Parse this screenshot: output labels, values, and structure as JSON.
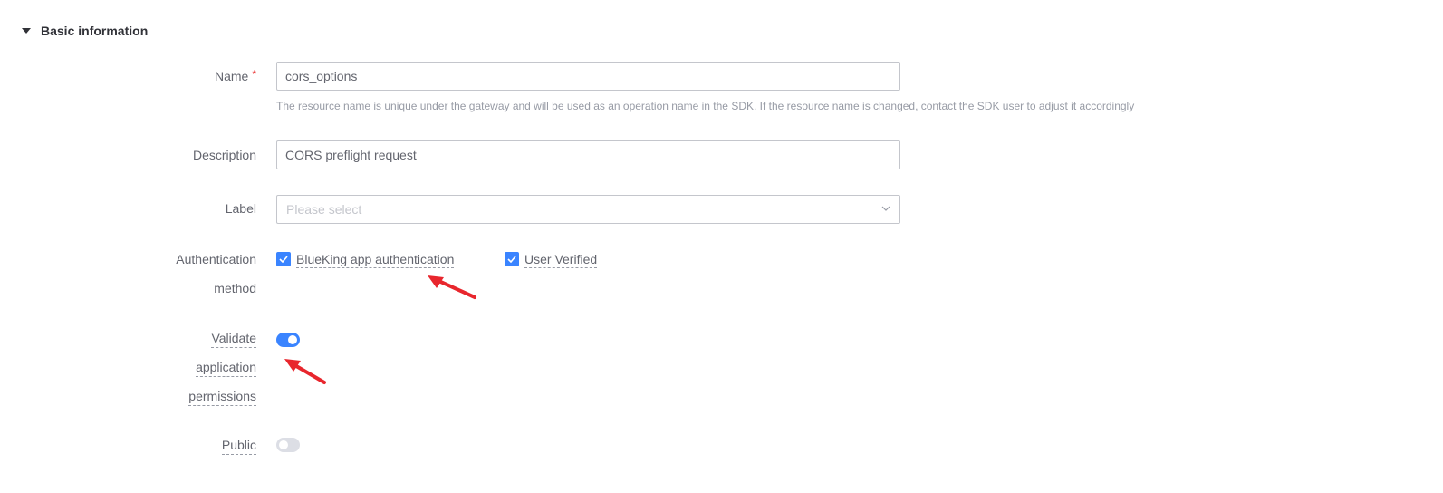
{
  "section": {
    "title": "Basic information"
  },
  "form": {
    "name": {
      "label": "Name",
      "required_mark": "*",
      "value": "cors_options",
      "hint": "The resource name is unique under the gateway and will be used as an operation name in the SDK. If the resource name is changed, contact the SDK user to adjust it accordingly"
    },
    "description": {
      "label": "Description",
      "value": "CORS preflight request"
    },
    "label_field": {
      "label": "Label",
      "placeholder": "Please select"
    },
    "auth": {
      "label_line1": "Authentication",
      "label_line2": "method",
      "options": [
        {
          "label": "BlueKing app authentication",
          "checked": true
        },
        {
          "label": "User Verified",
          "checked": true
        }
      ]
    },
    "validate_permissions": {
      "label_line1": "Validate",
      "label_line2": "application",
      "label_line3": "permissions",
      "enabled": true
    },
    "public": {
      "label": "Public",
      "enabled": false
    }
  },
  "colors": {
    "primary": "#3a84ff",
    "annotation_arrow": "#e8262d",
    "required": "#ea3636"
  }
}
